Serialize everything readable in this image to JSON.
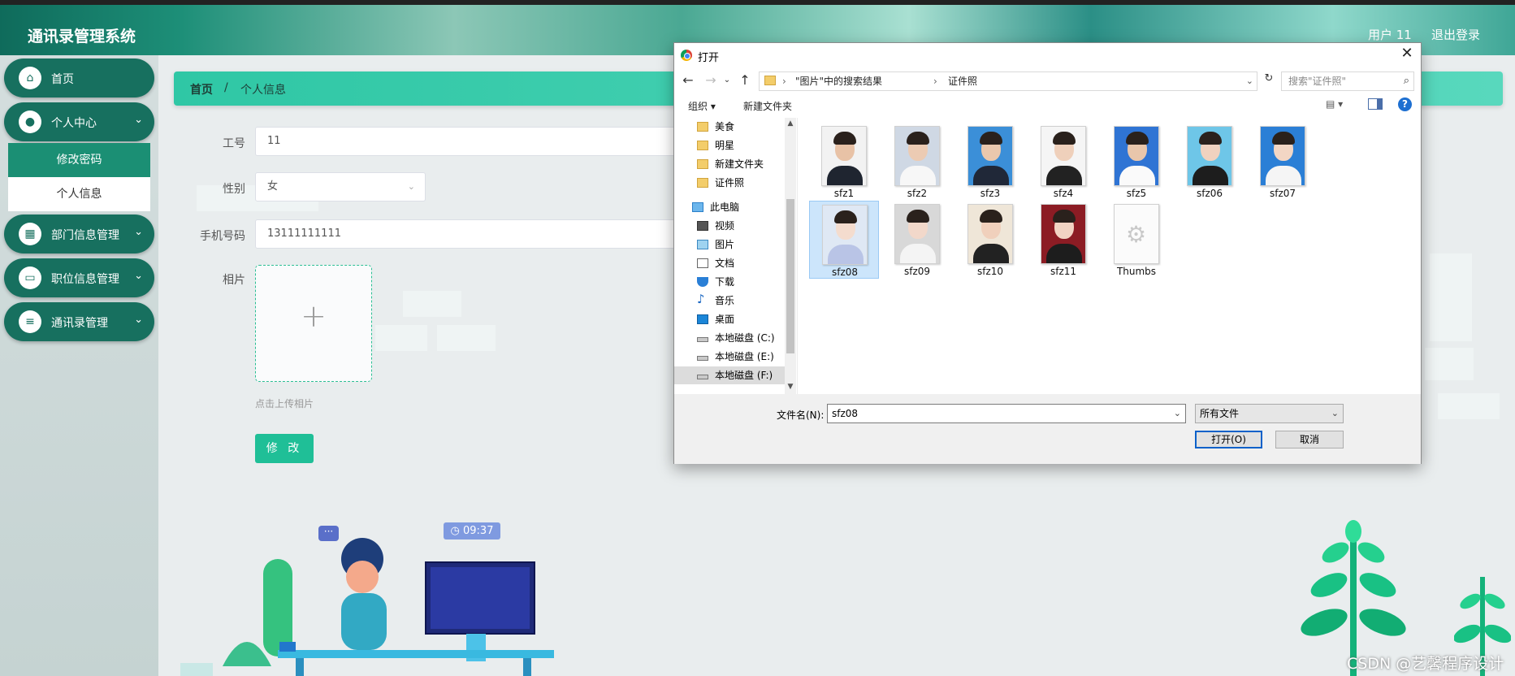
{
  "app": {
    "title": "通讯录管理系统",
    "user": "用户 11",
    "logout": "退出登录"
  },
  "sidebar": {
    "items": [
      {
        "label": "首页",
        "icon": "home-icon"
      },
      {
        "label": "个人中心",
        "icon": "user-icon"
      },
      {
        "label": "部门信息管理",
        "icon": "grid-icon"
      },
      {
        "label": "职位信息管理",
        "icon": "monitor-icon"
      },
      {
        "label": "通讯录管理",
        "icon": "sliders-icon"
      }
    ],
    "sub_items": [
      "修改密码",
      "个人信息"
    ],
    "expanded_chevron": "⌄",
    "collapsed_chevron": "›"
  },
  "breadcrumb": {
    "home": "首页",
    "sep": "/",
    "current": "个人信息"
  },
  "form": {
    "labels": {
      "id": "工号",
      "gender": "性别",
      "phone": "手机号码",
      "photo": "相片"
    },
    "values": {
      "id": "11",
      "gender": "女",
      "phone": "13111111111"
    },
    "upload_hint": "点击上传相片",
    "submit_label": "修 改"
  },
  "illustration": {
    "clock": "09:37",
    "chat": "···"
  },
  "watermark": "CSDN @艺馨程序设计",
  "dialog": {
    "title": "打开",
    "address": {
      "part1": "\"图片\"中的搜索结果",
      "part2": "证件照"
    },
    "search_placeholder": "搜索\"证件照\"",
    "toolbar": {
      "organize": "组织 ▾",
      "new_folder": "新建文件夹"
    },
    "tree": [
      {
        "label": "美食",
        "icon": "folder"
      },
      {
        "label": "明星",
        "icon": "folder"
      },
      {
        "label": "新建文件夹",
        "icon": "folder"
      },
      {
        "label": "证件照",
        "icon": "folder"
      },
      {
        "label": "此电脑",
        "icon": "pc"
      },
      {
        "label": "视频",
        "icon": "video"
      },
      {
        "label": "图片",
        "icon": "pic"
      },
      {
        "label": "文档",
        "icon": "doc"
      },
      {
        "label": "下载",
        "icon": "down"
      },
      {
        "label": "音乐",
        "icon": "music"
      },
      {
        "label": "桌面",
        "icon": "desk"
      },
      {
        "label": "本地磁盘 (C:)",
        "icon": "disk"
      },
      {
        "label": "本地磁盘 (E:)",
        "icon": "disk"
      },
      {
        "label": "本地磁盘 (F:)",
        "icon": "disk"
      }
    ],
    "files": [
      {
        "name": "sfz1"
      },
      {
        "name": "sfz2"
      },
      {
        "name": "sfz3"
      },
      {
        "name": "sfz4"
      },
      {
        "name": "sfz5"
      },
      {
        "name": "sfz06"
      },
      {
        "name": "sfz07"
      },
      {
        "name": "sfz08",
        "selected": true
      },
      {
        "name": "sfz09"
      },
      {
        "name": "sfz10"
      },
      {
        "name": "sfz11"
      },
      {
        "name": "Thumbs"
      }
    ],
    "filename_label": "文件名(N):",
    "filename_value": "sfz08",
    "filetype": "所有文件",
    "open_label": "打开(O)",
    "cancel_label": "取消"
  }
}
